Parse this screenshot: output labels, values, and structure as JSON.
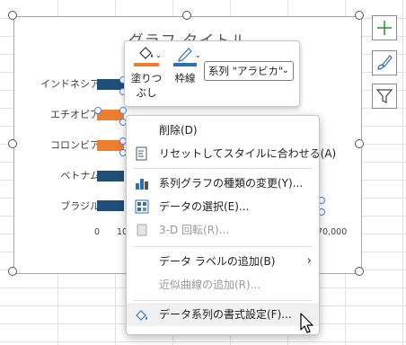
{
  "chart": {
    "title": "グラフ タイトル",
    "categories": [
      "インドネシア",
      "エチオピア",
      "コロンビア",
      "ベトナム",
      "ブラジル"
    ],
    "x_ticks": [
      "0",
      "10",
      "70,000"
    ]
  },
  "chart_data": {
    "type": "bar",
    "title": "グラフ タイトル",
    "categories": [
      "インドネシア",
      "エチオピア",
      "コロンビア",
      "ベトナム",
      "ブラジル"
    ],
    "series": [
      {
        "name": "アラビカ",
        "color": "#ed7d31"
      },
      {
        "color": "#1f4e79"
      }
    ],
    "x_ticks": [
      "0",
      "10",
      "70,000"
    ]
  },
  "side_buttons": [
    {
      "name": "chart-elements-button",
      "icon": "plus-icon"
    },
    {
      "name": "chart-styles-button",
      "icon": "paintbrush-icon"
    },
    {
      "name": "chart-filters-button",
      "icon": "funnel-icon"
    }
  ],
  "mini_toolbar": {
    "fill_label_1": "塗りつ",
    "fill_label_2": "ぶし",
    "outline_label": "枠線",
    "series_select": "系列 \"アラビカ\"",
    "fill_color": "#ed7d31",
    "outline_color": "#2f6fb0"
  },
  "context_menu": {
    "items": [
      {
        "label": "削除(D)",
        "icon": "none",
        "enabled": true
      },
      {
        "label": "リセットしてスタイルに合わせる(A)",
        "icon": "reset-style-icon",
        "enabled": true
      },
      {
        "label": "系列グラフの種類の変更(Y)...",
        "icon": "bar-chart-icon",
        "enabled": true
      },
      {
        "label": "データの選択(E)...",
        "icon": "select-data-icon",
        "enabled": true
      },
      {
        "label": "3-D 回転(R)...",
        "icon": "3d-rotate-icon",
        "enabled": false
      },
      {
        "label": "データ ラベルの追加(B)",
        "icon": "none",
        "enabled": true,
        "submenu": true
      },
      {
        "label": "近似曲線の追加(R)...",
        "icon": "none",
        "enabled": false
      },
      {
        "label": "データ系列の書式設定(F)...",
        "icon": "format-series-icon",
        "enabled": true
      }
    ]
  },
  "colors": {
    "orange_bar": "#ed7d31",
    "blue_bar": "#1f4e79",
    "selection": "#4a86e8",
    "plus_green": "#2e9b3a"
  }
}
